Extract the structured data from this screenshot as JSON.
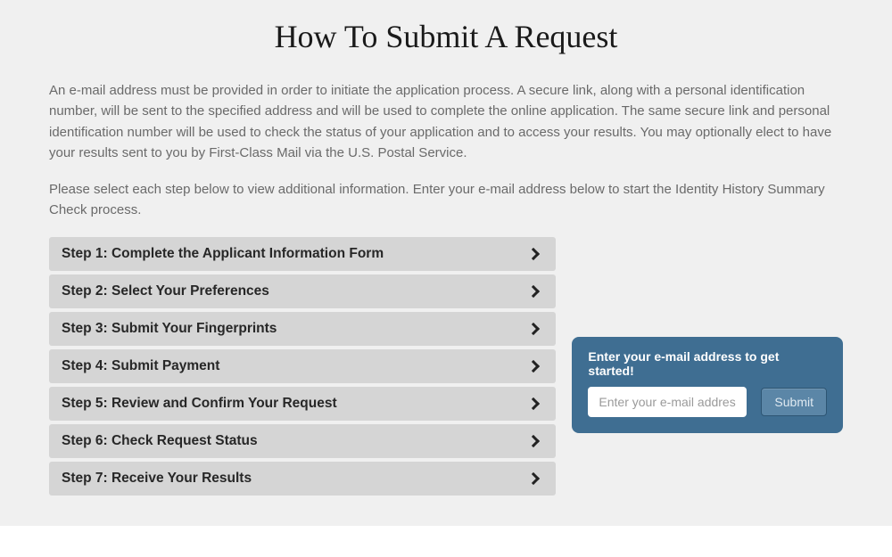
{
  "title": "How To Submit A Request",
  "intro1": "An e-mail address must be provided in order to initiate the application process. A secure link, along with a personal identification number, will be sent to the specified address and will be used to complete the online application. The same secure link and personal identification number will be used to check the status of your application and to access your results. You may optionally elect to have your results sent to you by First-Class Mail via the U.S. Postal Service.",
  "intro2": "Please select each step below to view additional information. Enter your e-mail address below to start the Identity History Summary Check process.",
  "steps": [
    {
      "label": "Step 1: Complete the Applicant Information Form"
    },
    {
      "label": "Step 2: Select Your Preferences"
    },
    {
      "label": "Step 3: Submit Your Fingerprints"
    },
    {
      "label": "Step 4: Submit Payment"
    },
    {
      "label": "Step 5: Review and Confirm Your Request"
    },
    {
      "label": "Step 6: Check Request Status"
    },
    {
      "label": "Step 7: Receive Your Results"
    }
  ],
  "email_box": {
    "prompt": "Enter your e-mail address to get started!",
    "placeholder": "Enter your e-mail address",
    "submit": "Submit"
  }
}
